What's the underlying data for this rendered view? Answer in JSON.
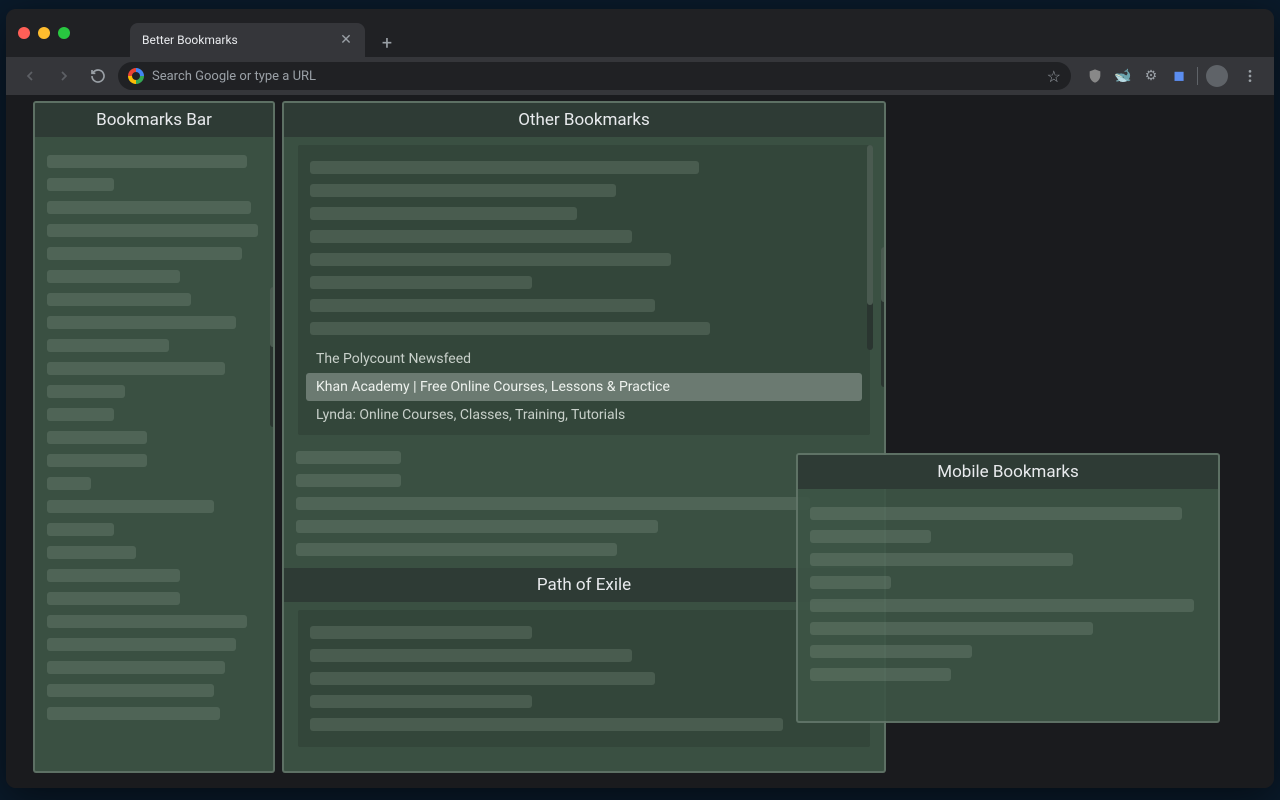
{
  "window": {
    "tab_title": "Better Bookmarks"
  },
  "omnibox": {
    "placeholder": "Search Google or type a URL"
  },
  "panels": {
    "bookmarks_bar": {
      "title": "Bookmarks Bar"
    },
    "other_bookmarks": {
      "title": "Other Bookmarks",
      "clear_items": [
        "The Polycount Newsfeed",
        "Khan Academy | Free Online Courses, Lessons & Practice",
        "Lynda: Online Courses, Classes, Training, Tutorials"
      ],
      "sub_header": "Path of Exile"
    },
    "mobile_bookmarks": {
      "title": "Mobile Bookmarks"
    }
  }
}
